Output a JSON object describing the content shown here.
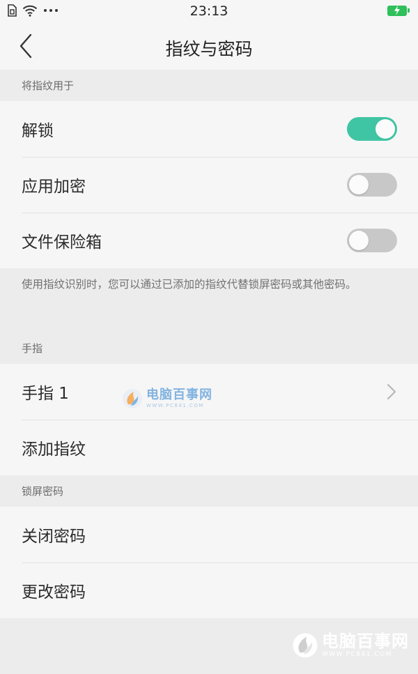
{
  "status_bar": {
    "time": "23:13",
    "icons": [
      "sim-icon",
      "wifi-icon",
      "more-dots-icon",
      "battery-charging-icon"
    ],
    "battery_color": "#2fbf5b"
  },
  "nav": {
    "title": "指纹与密码",
    "back_icon": "back-chevron-icon"
  },
  "fingerprint_use": {
    "header": "将指纹用于",
    "items": [
      {
        "label": "解锁",
        "enabled": true
      },
      {
        "label": "应用加密",
        "enabled": false
      },
      {
        "label": "文件保险箱",
        "enabled": false
      }
    ],
    "hint": "使用指纹识别时，您可以通过已添加的指纹代替锁屏密码或其他密码。"
  },
  "fingers": {
    "header": "手指",
    "items": [
      {
        "label": "手指 1",
        "icon": "chevron-right-icon"
      },
      {
        "label": "添加指纹"
      }
    ]
  },
  "lock_password": {
    "header": "锁屏密码",
    "items": [
      {
        "label": "关闭密码"
      },
      {
        "label": "更改密码"
      }
    ]
  },
  "watermark": {
    "title": "电脑百事网",
    "url": "WWW.PC841.COM"
  },
  "colors": {
    "accent": "#3fc5a3",
    "toggle_off": "#c8c8c8",
    "background": "#ececec",
    "list_background": "#f6f6f6"
  }
}
